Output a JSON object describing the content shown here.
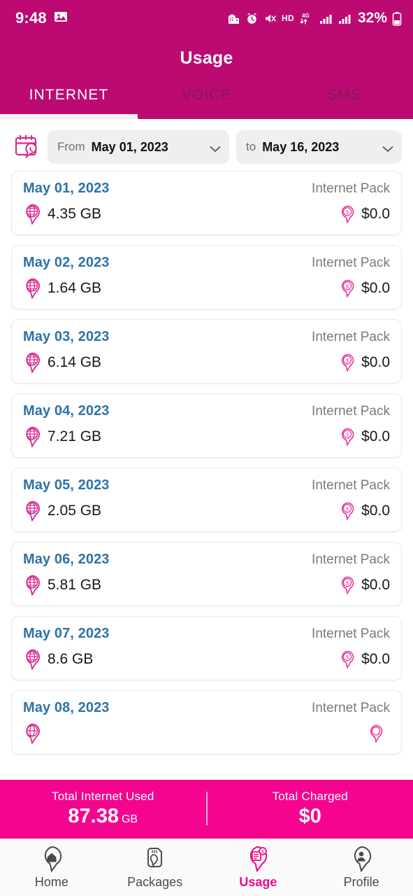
{
  "status_bar": {
    "time": "9:48",
    "left_icons": [
      "image-icon"
    ],
    "right_icons": [
      "app-icon",
      "alarm-clock-icon",
      "mute-vibrate-icon",
      "hd-icon",
      "4g-data-icon",
      "signal-bars-1-icon",
      "signal-bars-2-icon"
    ],
    "hd_label": "HD",
    "network_label": "4G",
    "battery_percent": "32%"
  },
  "header": {
    "title": "Usage",
    "background_color": "#BC0A72",
    "tabs": [
      {
        "label": "INTERNET",
        "active": true
      },
      {
        "label": "VOICE",
        "active": false
      },
      {
        "label": "SMS",
        "active": false
      }
    ]
  },
  "date_range": {
    "calendar_icon": "calendar-clock-icon",
    "from_label": "From",
    "from_value": "May 01, 2023",
    "to_label": "to",
    "to_value": "May 16, 2023"
  },
  "usage_list": {
    "items": [
      {
        "date": "May 01, 2023",
        "pack": "Internet Pack",
        "amount": "4.35 GB",
        "cost": "$0.0"
      },
      {
        "date": "May 02, 2023",
        "pack": "Internet Pack",
        "amount": "1.64 GB",
        "cost": "$0.0"
      },
      {
        "date": "May 03, 2023",
        "pack": "Internet Pack",
        "amount": "6.14 GB",
        "cost": "$0.0"
      },
      {
        "date": "May 04, 2023",
        "pack": "Internet Pack",
        "amount": "7.21 GB",
        "cost": "$0.0"
      },
      {
        "date": "May 05, 2023",
        "pack": "Internet Pack",
        "amount": "2.05 GB",
        "cost": "$0.0"
      },
      {
        "date": "May 06, 2023",
        "pack": "Internet Pack",
        "amount": "5.81 GB",
        "cost": "$0.0"
      },
      {
        "date": "May 07, 2023",
        "pack": "Internet Pack",
        "amount": "8.6 GB",
        "cost": "$0.0"
      },
      {
        "date": "May 08, 2023",
        "pack": "Internet Pack",
        "amount": "",
        "cost": ""
      }
    ]
  },
  "summary": {
    "background_color": "#F5058F",
    "internet_label": "Total Internet Used",
    "internet_value": "87.38",
    "internet_unit": "GB",
    "charged_label": "Total Charged",
    "charged_value": "$0"
  },
  "bottom_nav": {
    "accent_color": "#ED0A8C",
    "items": [
      {
        "label": "Home",
        "icon": "home-pin-icon",
        "active": false
      },
      {
        "label": "Packages",
        "icon": "sim-card-pin-icon",
        "active": false
      },
      {
        "label": "Usage",
        "icon": "usage-bill-pin-icon",
        "active": true
      },
      {
        "label": "Profile",
        "icon": "person-pin-icon",
        "active": false
      }
    ]
  },
  "colors": {
    "header_pink": "#BC0A72",
    "summary_pink": "#F5058F",
    "accent_pink": "#ED0A8C",
    "date_blue": "#2E72A8"
  }
}
